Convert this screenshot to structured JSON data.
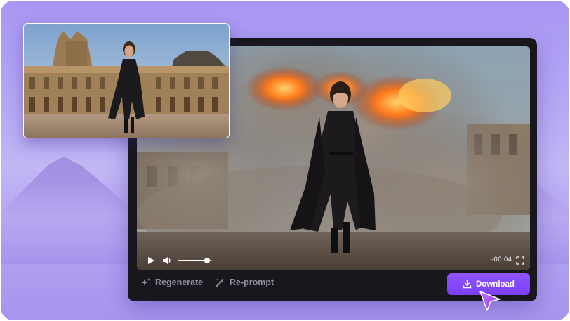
{
  "player": {
    "time": "-00:04",
    "volume_level": 0.85
  },
  "actions": {
    "regenerate": "Regenerate",
    "reprompt": "Re-prompt",
    "download": "Download"
  },
  "icons": {
    "play": "play-icon",
    "volume": "volume-icon",
    "fullscreen": "fullscreen-icon",
    "regenerate": "sparkle-icon",
    "reprompt": "magic-wand-icon",
    "download": "download-icon",
    "cursor": "pointer-cursor-icon"
  },
  "colors": {
    "accent": "#7c3ff6",
    "player_bg": "#18171d",
    "muted_text": "#8f8d99",
    "background": "#b3a5f4"
  }
}
